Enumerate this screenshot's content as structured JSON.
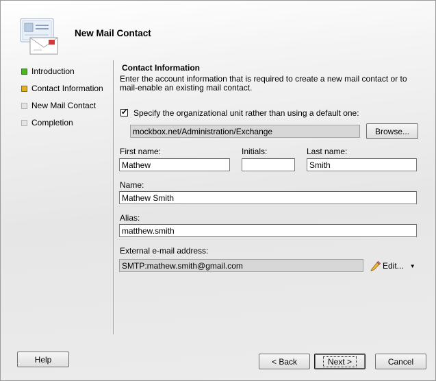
{
  "window": {
    "title": "New Mail Contact"
  },
  "nav": {
    "items": [
      {
        "label": "Introduction",
        "state": "complete",
        "color": "#4bb521"
      },
      {
        "label": "Contact Information",
        "state": "current",
        "color": "#e0b020"
      },
      {
        "label": "New Mail Contact",
        "state": "pending",
        "color": "#cfcfcf"
      },
      {
        "label": "Completion",
        "state": "pending",
        "color": "#cfcfcf"
      }
    ]
  },
  "content": {
    "section_title": "Contact Information",
    "description": "Enter the account information that is required to create a new mail contact or to mail-enable an existing mail contact.",
    "ou": {
      "checked": true,
      "checkbox_label": "Specify the organizational unit rather than using a default one:",
      "value": "mockbox.net/Administration/Exchange",
      "browse_label": "Browse..."
    },
    "first_name": {
      "label": "First name:",
      "value": "Mathew"
    },
    "initials": {
      "label": "Initials:",
      "value": ""
    },
    "last_name": {
      "label": "Last name:",
      "value": "Smith"
    },
    "name": {
      "label": "Name:",
      "value": "Mathew Smith"
    },
    "alias": {
      "label": "Alias:",
      "value": "matthew.smith"
    },
    "external_email": {
      "label": "External e-mail address:",
      "value": "SMTP:mathew.smith@gmail.com",
      "edit_label": "Edit..."
    }
  },
  "footer": {
    "help_label": "Help",
    "back_label": "< Back",
    "next_label": "Next >",
    "cancel_label": "Cancel"
  },
  "icons": {
    "header": "mail-contact-wizard-icon",
    "edit": "pencil-icon",
    "dropdown": "caret-down-icon"
  }
}
